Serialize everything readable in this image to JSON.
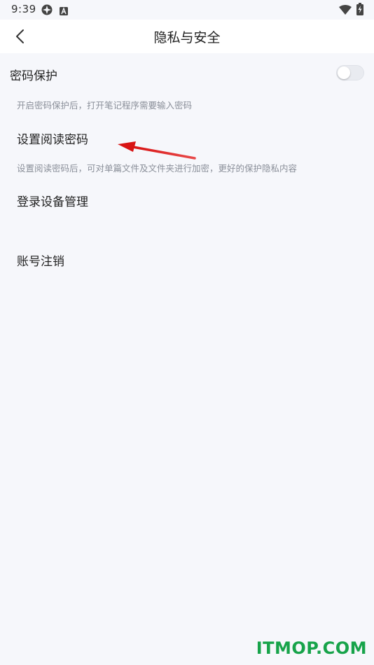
{
  "status_bar": {
    "time": "9:39",
    "icons": [
      "notification-app-icon",
      "font-a-icon",
      "wifi-icon",
      "battery-charging-icon"
    ]
  },
  "header": {
    "title": "隐私与安全",
    "back_icon": "chevron-left-icon"
  },
  "settings": {
    "password_protection": {
      "title": "密码保护",
      "description": "开启密码保护后，打开笔记程序需要输入密码",
      "toggle_on": false
    },
    "reading_password": {
      "title": "设置阅读密码",
      "description": "设置阅读密码后，可对单篇文件及文件夹进行加密，更好的保护隐私内容"
    },
    "device_management": {
      "title": "登录设备管理"
    },
    "account_cancel": {
      "title": "账号注销"
    }
  },
  "annotation": {
    "arrow_color": "#e02020"
  },
  "watermark": {
    "text": "ITMOP.COM",
    "color": "#17a34a"
  },
  "colors": {
    "background": "#f6f7fb",
    "header_bg": "#ffffff",
    "text_primary": "#222222",
    "text_secondary": "#8a8f99"
  }
}
